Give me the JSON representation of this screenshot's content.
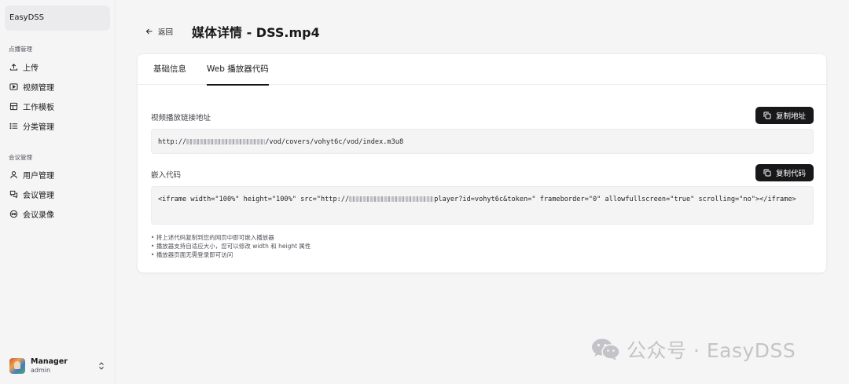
{
  "brand": "EasyDSS",
  "sidebar": {
    "groups": [
      {
        "label": "点播管理",
        "items": [
          {
            "label": "上传",
            "icon": "upload-icon"
          },
          {
            "label": "视频管理",
            "icon": "video-icon"
          },
          {
            "label": "工作模板",
            "icon": "template-icon"
          },
          {
            "label": "分类管理",
            "icon": "list-icon"
          }
        ]
      },
      {
        "label": "会议管理",
        "items": [
          {
            "label": "用户管理",
            "icon": "user-icon"
          },
          {
            "label": "会议管理",
            "icon": "meeting-icon"
          },
          {
            "label": "会议录像",
            "icon": "record-icon"
          }
        ]
      }
    ],
    "user": {
      "name": "Manager",
      "role": "admin"
    }
  },
  "header": {
    "back_label": "返回",
    "title": "媒体详情 - DSS.mp4"
  },
  "tabs": [
    {
      "label": "基础信息",
      "active": false
    },
    {
      "label": "Web 播放器代码",
      "active": true
    }
  ],
  "play_url": {
    "label": "视频播放链接地址",
    "button": "复制地址",
    "prefix": "http://",
    "suffix": "/vod/covers/vohyt6c/vod/index.m3u8"
  },
  "embed": {
    "label": "嵌入代码",
    "button": "复制代码",
    "prefix": "<iframe width=\"100%\" height=\"100%\" src=\"http://",
    "suffix": "player?id=vohyt6c&token=\" frameborder=\"0\" allowfullscreen=\"true\" scrolling=\"no\"></iframe>"
  },
  "notes": [
    "• 将上述代码复制到您的网页中即可嵌入播放器",
    "• 播放器支持自适应大小，您可以修改 width 和 height 属性",
    "• 播放器页面无需登录即可访问"
  ],
  "watermark": "公众号 · EasyDSS",
  "colors": {
    "primary": "#18181b",
    "background": "#f5f5f6",
    "card": "#ffffff"
  }
}
